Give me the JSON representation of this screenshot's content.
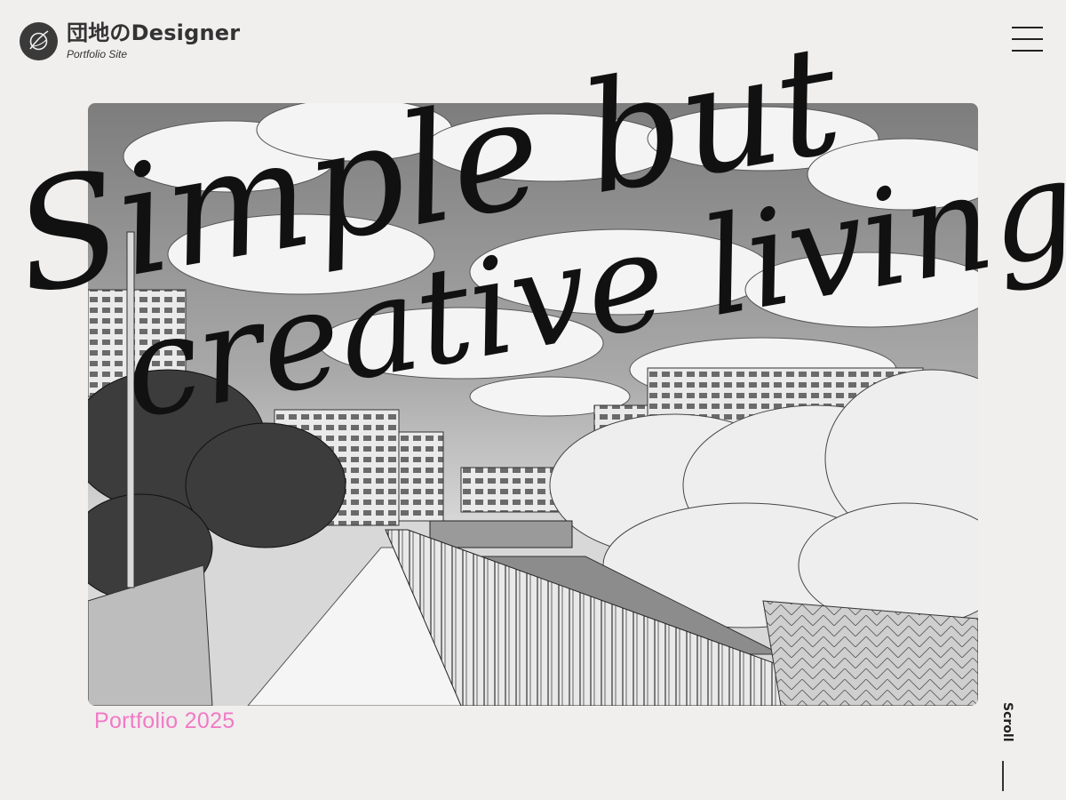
{
  "header": {
    "logo_icon": "signature-logo-icon",
    "title": "団地のDesigner",
    "subtitle": "Portfolio Site",
    "menu_icon": "hamburger-menu-icon"
  },
  "hero": {
    "headline_line1": "Simple but",
    "headline_line2": "creative living.",
    "image_alt": "monochrome anime illustration of apartment blocks along a river with cherry trees",
    "caption": "Portfolio 2025"
  },
  "scroll": {
    "label": "Scroll"
  },
  "colors": {
    "background": "#f1eeee",
    "accent_pink": "#f07bc4",
    "text_dark": "#222222"
  }
}
